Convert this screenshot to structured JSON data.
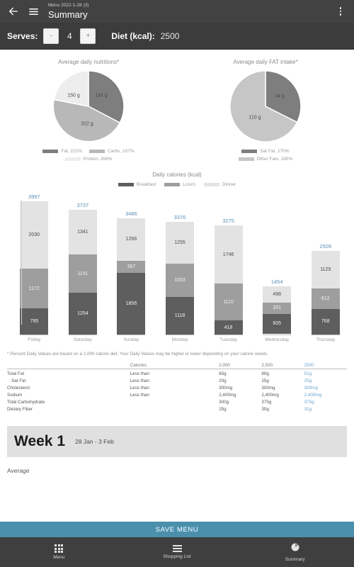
{
  "appbar": {
    "back_icon": "arrow-left-icon",
    "menu_icon": "hamburger-icon",
    "subtitle": "Menu 2022-1-28 (3)",
    "title": "Summary",
    "overflow_icon": "more-vertical-icon"
  },
  "serves_bar": {
    "serves_label": "Serves:",
    "decrement_label": "-",
    "serves_value": "4",
    "increment_label": "+",
    "diet_label": "Diet (kcal):",
    "diet_value": "2500"
  },
  "colors": {
    "accent_blue": "#4a90ad",
    "value_blue": "#6ba4cc",
    "breakfast": "#5e5e5e",
    "lunch": "#9e9e9e",
    "dinner": "#e3e3e3",
    "fat": "#7e7e7e",
    "carbs": "#b8b8b8",
    "protein": "#ededed",
    "sat_fat": "#7e7e7e",
    "other_fats": "#c6c6c6",
    "appbar_bg": "#424242"
  },
  "chart_data": [
    {
      "type": "pie",
      "title": "Average daily nutritions*",
      "categories": [
        "Fat",
        "Carbs",
        "Protein"
      ],
      "values": [
        144,
        322,
        150
      ],
      "value_labels": [
        "144 g",
        "322 g",
        "150 g"
      ],
      "unit": "g",
      "legend": [
        "Fat, 222%",
        "Carbs, 107%",
        "Protein, 269%"
      ],
      "legend_position": "bottom",
      "colors": [
        "#7e7e7e",
        "#b8b8b8",
        "#ededed"
      ]
    },
    {
      "type": "pie",
      "title": "Average daily FAT intake*",
      "categories": [
        "Sat Fat",
        "Other Fats"
      ],
      "values": [
        34,
        110
      ],
      "value_labels": [
        "34 g",
        "110 g"
      ],
      "unit": "g",
      "legend": [
        "Sat Fat, 170%",
        "Other Fats, 245%"
      ],
      "legend_position": "bottom",
      "colors": [
        "#7e7e7e",
        "#c6c6c6"
      ]
    },
    {
      "type": "bar",
      "subtype": "stacked",
      "title": "Daily calories (kcal)",
      "xlabel": "",
      "ylabel": "kcal",
      "ylim": [
        0,
        3997
      ],
      "grid": false,
      "legend_position": "top",
      "categories": [
        "Friday",
        "Saturday",
        "Sunday",
        "Monday",
        "Tuesday",
        "Wednesday",
        "Thursday"
      ],
      "series": [
        {
          "name": "Breakfast",
          "color": "#5e5e5e",
          "values": [
            795,
            1254,
            1856,
            1118,
            418,
            605,
            768
          ]
        },
        {
          "name": "Lunch",
          "color": "#9e9e9e",
          "values": [
            1172,
            1141,
            367,
            1003,
            1110,
            331,
            612
          ]
        },
        {
          "name": "Dinner",
          "color": "#e3e3e3",
          "values": [
            2030,
            1341,
            1266,
            1255,
            1746,
            498,
            1129
          ]
        }
      ],
      "totals": [
        3997,
        3737,
        3486,
        3376,
        3275,
        1454,
        2509
      ]
    }
  ],
  "footnote": "* Percent Daily Values are based on a 2,000 calorie diet. Your Daily Values may be higher or lower depending on your calorie needs.",
  "dv_table": {
    "headers": [
      "",
      "Calories",
      "2,000",
      "2,500",
      "2500"
    ],
    "rows": [
      {
        "name": "Total Fat",
        "mid": "Less than",
        "v2000": "65g",
        "v2500": "80g",
        "vcustom": "51g",
        "indent": false
      },
      {
        "name": "Sat Fat",
        "mid": "Less than",
        "v2000": "20g",
        "v2500": "25g",
        "vcustom": "25g",
        "indent": true
      },
      {
        "name": "Cholesterol",
        "mid": "Less than",
        "v2000": "300mg",
        "v2500": "300mg",
        "vcustom": "300mg",
        "indent": false
      },
      {
        "name": "Sodium",
        "mid": "Less than",
        "v2000": "2,400mg",
        "v2500": "2,400mg",
        "vcustom": "2,400mg",
        "indent": false
      },
      {
        "name": "Total Carbohydrate",
        "mid": "",
        "v2000": "300g",
        "v2500": "375g",
        "vcustom": "375g",
        "indent": false
      },
      {
        "name": "Dietary Fiber",
        "mid": "",
        "v2000": "25g",
        "v2500": "30g",
        "vcustom": "31g",
        "indent": false
      }
    ]
  },
  "week": {
    "title": "Week 1",
    "range": "28 Jan - 3 Feb",
    "average_label": "Average"
  },
  "save_bar": {
    "label": "SAVE MENU"
  },
  "bottom_nav": {
    "items": [
      {
        "label": "Menu",
        "icon": "grid-icon"
      },
      {
        "label": "Shopping List",
        "icon": "list-lines-icon"
      },
      {
        "label": "Summary",
        "icon": "pie-chart-icon"
      }
    ]
  }
}
